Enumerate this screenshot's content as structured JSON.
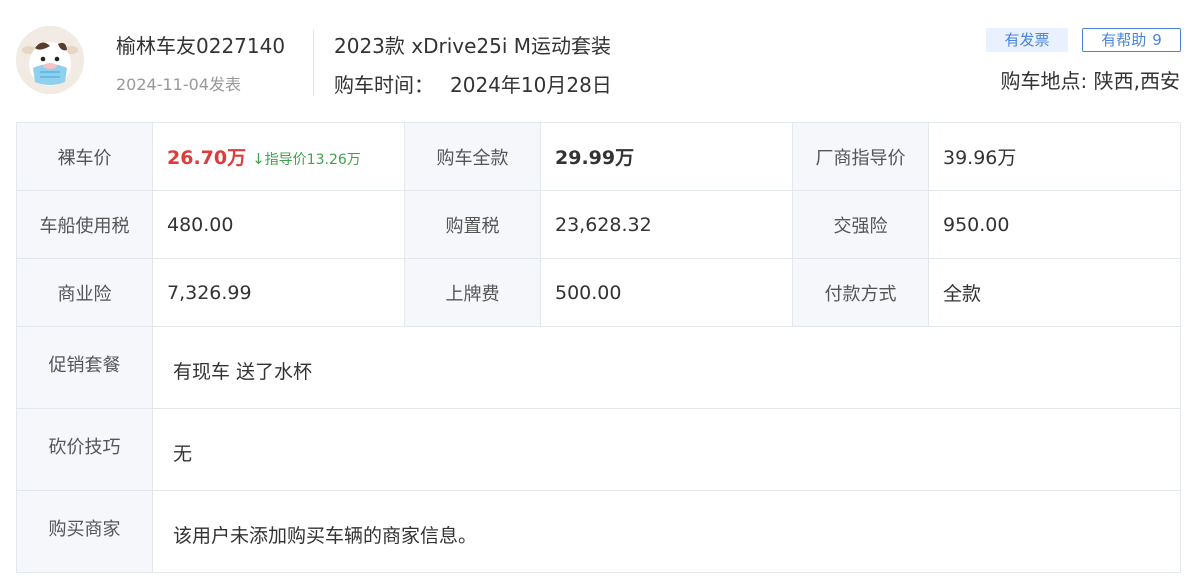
{
  "user": {
    "name": "榆林车友0227140",
    "post_date": "2024-11-04发表",
    "avatar_icon": "cow-mascot-avatar"
  },
  "car": {
    "model": "2023款 xDrive25i M运动套装",
    "purchase_time_label": "购车时间：",
    "purchase_time": "2024年10月28日"
  },
  "badges": {
    "invoice": "有发票",
    "helpful_label": "有帮助",
    "helpful_count": "9"
  },
  "location": "购车地点: 陕西,西安",
  "table": {
    "bare_price_label": "裸车价",
    "bare_price": "26.70万",
    "bare_price_delta": "指导价13.26万",
    "bare_price_delta_icon": "down-arrow-icon",
    "full_price_label": "购车全款",
    "full_price": "29.99万",
    "msrp_label": "厂商指导价",
    "msrp": "39.96万",
    "vehicle_tax_label": "车船使用税",
    "vehicle_tax": "480.00",
    "purchase_tax_label": "购置税",
    "purchase_tax": "23,628.32",
    "compulsory_ins_label": "交强险",
    "compulsory_ins": "950.00",
    "commercial_ins_label": "商业险",
    "commercial_ins": "7,326.99",
    "plate_fee_label": "上牌费",
    "plate_fee": "500.00",
    "payment_label": "付款方式",
    "payment": "全款",
    "promo_label": "促销套餐",
    "promo": "有现车 送了水杯",
    "bargain_label": "砍价技巧",
    "bargain": "无",
    "dealer_label": "购买商家",
    "dealer": "该用户未添加购买车辆的商家信息。"
  },
  "colors": {
    "accent_blue": "#4a84d8",
    "price_red": "#e03b3b",
    "delta_green": "#3fa34d",
    "label_bg": "#f5f7fa",
    "border": "#e3e8ee"
  }
}
